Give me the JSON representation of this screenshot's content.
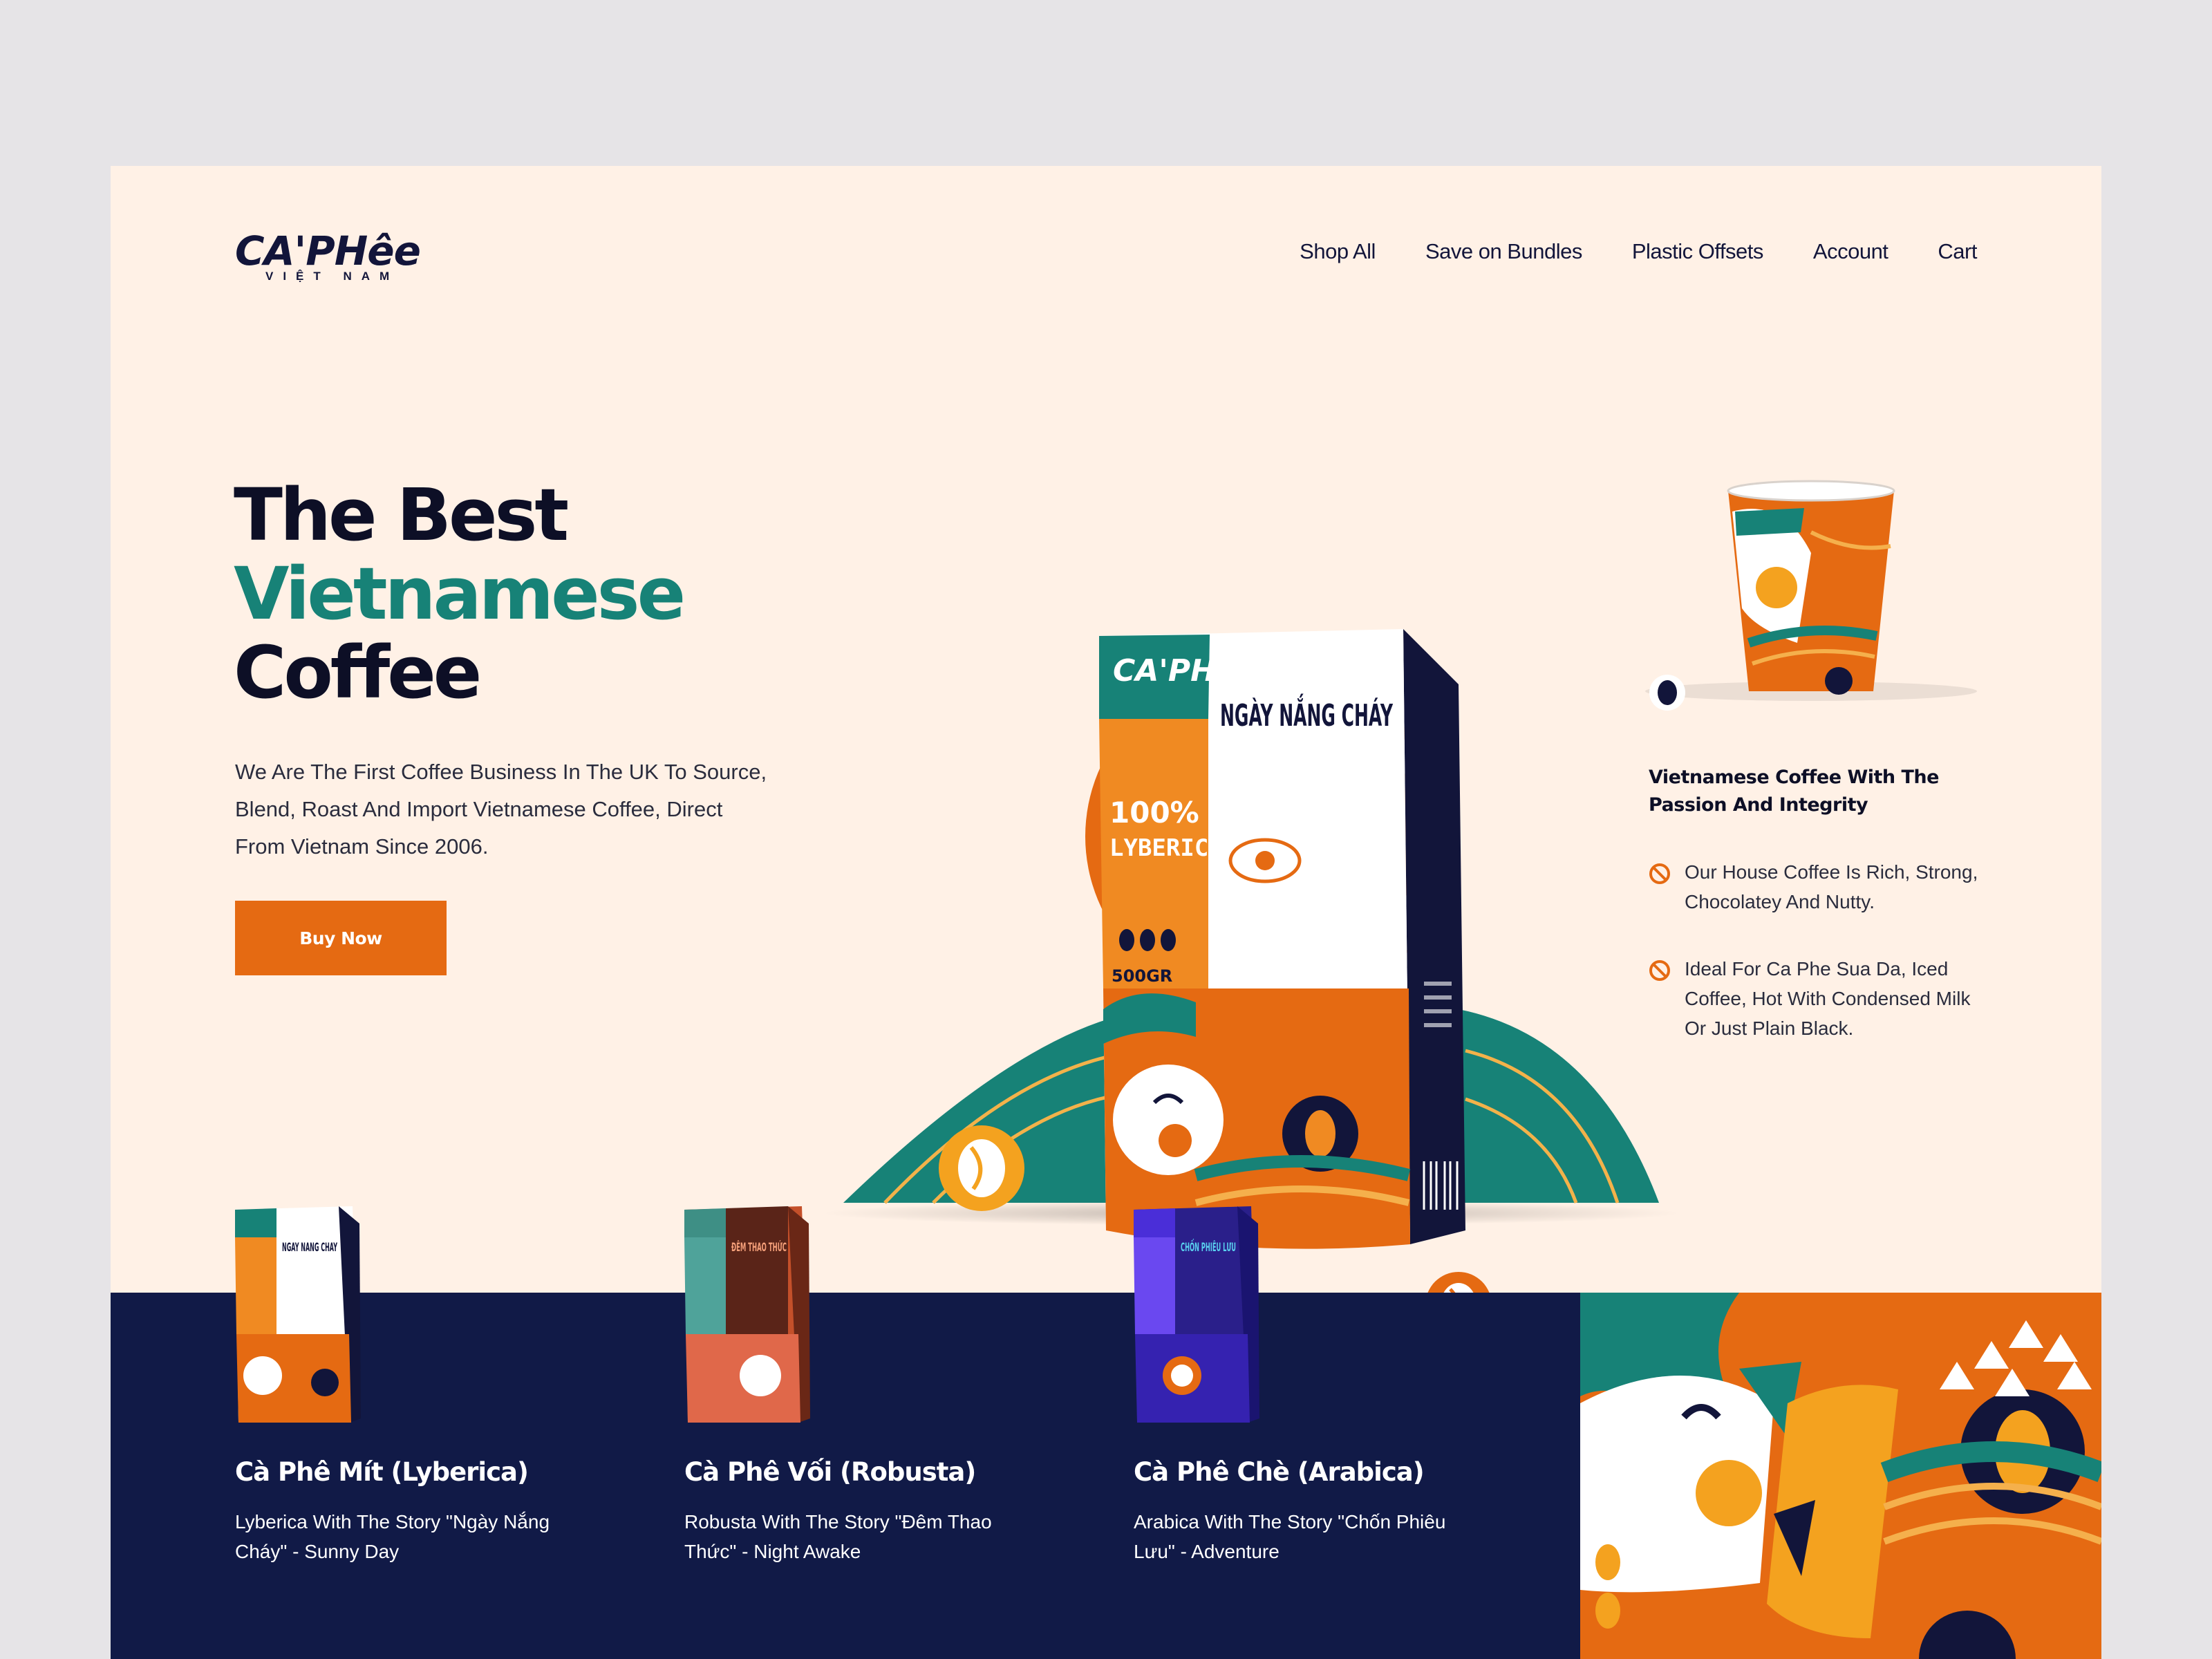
{
  "brand": {
    "name": "CA'PHêe",
    "subtitle": "VIỆT NAM"
  },
  "nav": {
    "items": [
      "Shop All",
      "Save on Bundles",
      "Plastic Offsets",
      "Account",
      "Cart"
    ]
  },
  "hero": {
    "title_line1": "The Best",
    "title_line2": "Vietnamese",
    "title_line3": "Coffee",
    "description": "We Are The First Coffee Business In The UK To Source, Blend, Roast And Import Vietnamese Coffee, Direct From Vietnam Since 2006.",
    "buy_button": "Buy Now"
  },
  "package": {
    "brand": "CA'PHêe",
    "blend_name": "NGÀY NẮNG CHÁY",
    "percent": "100%",
    "bean": "LYBERICA",
    "weight": "500GR"
  },
  "side": {
    "title": "Vietnamese Coffee With The Passion And Integrity",
    "bullets": [
      "Our House Coffee Is Rich, Strong, Chocolatey And Nutty.",
      "Ideal For Ca Phe Sua Da, Iced Coffee, Hot With Condensed Milk Or Just Plain Black."
    ]
  },
  "products": [
    {
      "name": "Cà Phê Mít (Lyberica)",
      "description": "Lyberica With The Story \"Ngày Nắng Cháy\" - Sunny Day",
      "pack_label": "NGAY NANG CHAY",
      "accent": "#178277",
      "body": "#ffffff",
      "side": "#12153a"
    },
    {
      "name": "Cà Phê Vối (Robusta)",
      "description": "Robusta With The Story \"Đêm Thao Thức\" - Night Awake",
      "pack_label": "ĐÊM THAO THỨC",
      "accent": "#3e8f85",
      "body": "#c4502a",
      "side": "#6a2716"
    },
    {
      "name": "Cà Phê Chè (Arabica)",
      "description": "Arabica With The Story \"Chốn Phiêu Lưu\" - Adventure",
      "pack_label": "CHỐN PHIÊU LƯU",
      "accent": "#4a2ed8",
      "body": "#2a1f8a",
      "side": "#1a1470"
    }
  ],
  "colors": {
    "orange": "#e56a12",
    "teal": "#178277",
    "navy": "#111a47",
    "cream": "#fff1e6"
  }
}
